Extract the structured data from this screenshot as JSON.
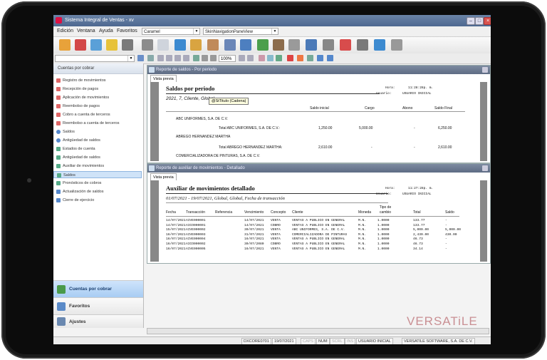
{
  "app": {
    "title": "Sistema Integral de Ventas - xv"
  },
  "menu": {
    "items": [
      "Edición",
      "Ventana",
      "Ayuda",
      "Favoritos"
    ],
    "theme_value": "Caramel",
    "skin_value": "SkinNavigationPaneView"
  },
  "toolbar": {
    "zoom": "100%"
  },
  "sidebar": {
    "header": "Cuentas por cobrar",
    "items": [
      {
        "label": "Registro de movimientos",
        "icon": "document-icon"
      },
      {
        "label": "Recepción de pagos",
        "icon": "document-icon"
      },
      {
        "label": "Aplicación de movimientos",
        "icon": "document-icon"
      },
      {
        "label": "Reembolso de pagos",
        "icon": "document-icon"
      },
      {
        "label": "Cobro a cuenta de terceros",
        "icon": "document-icon"
      },
      {
        "label": "Reembolso a cuenta de terceros",
        "icon": "document-icon"
      },
      {
        "label": "Saldos",
        "icon": "search-icon"
      },
      {
        "label": "Antigüedad de saldos",
        "icon": "search-icon"
      },
      {
        "label": "Estados de cuenta",
        "icon": "report-icon"
      },
      {
        "label": "Antigüedad de saldos",
        "icon": "report-icon"
      },
      {
        "label": "Auxiliar de movimientos",
        "icon": "report-icon"
      },
      {
        "label": "Saldos",
        "icon": "report-icon"
      },
      {
        "label": "Pronósticos de cobros",
        "icon": "report-icon"
      },
      {
        "label": "Actualización de saldos",
        "icon": "gear-icon"
      },
      {
        "label": "Cierre de ejercicio",
        "icon": "gear-icon"
      }
    ],
    "nav": [
      {
        "label": "Cuentas por cobrar",
        "icon": "money-icon"
      },
      {
        "label": "Favoritos",
        "icon": "star-icon"
      },
      {
        "label": "Ajustes",
        "icon": "gear-icon"
      }
    ]
  },
  "panel1": {
    "title": "Reporte de saldos - Por periodo",
    "tab": "Vista previa",
    "report_title": "Saldos por periodo",
    "subtitle": "2021, 7, Cliente, Global",
    "hora_label": "Hora:",
    "hora_value": "11:28:28p. m.",
    "usuario_label": "Usuario:",
    "usuario_value": "USUARIO INICIAL",
    "tooltip": "@StTitulo (Cadena)",
    "columns": [
      "Saldo inicial",
      "Cargo",
      "Abono",
      "Saldo Final"
    ],
    "lines": [
      {
        "name": "ABC UNIFORMES, S.A. DE C.V.",
        "total_label": "Total ABC UNIFORMES, S.A. DE C.V.:",
        "saldo_inicial": "1,250.00",
        "cargo": "5,000.00",
        "abono": "-",
        "saldo_final": "6,250.00"
      },
      {
        "name": "ABREGO HERNANDEZ MARTHA",
        "total_label": "Total ABREGO HERNANDEZ MARTHA:",
        "saldo_inicial": "2,610.00",
        "cargo": "-",
        "abono": "-",
        "saldo_final": "2,610.00"
      },
      {
        "name": "COMERCIALIZADORA DE PINTURAS, S.A. DE C.V."
      }
    ]
  },
  "panel2": {
    "title": "Reporte de auxiliar de movimientos - Detallado",
    "tab": "Vista previa",
    "report_title": "Auxiliar de movimientos detallado",
    "subtitle": "01/07/2021 - 19/07/2021, Global, Global, Fecha de transacción",
    "hora_label": "Hora:",
    "hora_value": "11:27:28p. m.",
    "usuario_label": "Usuario:",
    "usuario_value": "USUARIO INICIAL",
    "columns": [
      "Fecha",
      "Transacción",
      "Referencia",
      "Vencimiento",
      "Concepto",
      "Cliente",
      "Moneda",
      "Tipo de cambio",
      "Total",
      "Saldo"
    ],
    "rows": [
      [
        "14/07/2021",
        "AIVE000001",
        "",
        "14/07/2021",
        "VENTA",
        "VENTAS A PUBLICO EN GENERAL",
        "M.N.",
        "1.0000",
        "133.77",
        "-"
      ],
      [
        "14/07/2021",
        "AICO000001",
        "",
        "14/07/2021",
        "COBRO",
        "VENTAS A PUBLICO EN GENERAL",
        "M.N.",
        "1.0000",
        "133.77",
        "-"
      ],
      [
        "15/07/2021",
        "AIVE000002",
        "",
        "30/07/2021",
        "VENTA",
        "ABC UNIFORMES, S.A. DE C.V.",
        "M.N.",
        "1.0000",
        "5,000.00",
        "5,000.00"
      ],
      [
        "16/07/2021",
        "AIVE000003",
        "",
        "31/07/2021",
        "VENTA",
        "COMERCIALIZADORA DE PINTURAS",
        "M.N.",
        "1.0000",
        "2,430.00",
        "430.00"
      ],
      [
        "16/07/2021",
        "AIVE000004",
        "",
        "16/07/2021",
        "VENTA",
        "VENTAS A PUBLICO EN GENERAL",
        "M.N.",
        "1.0000",
        "46.73",
        "-"
      ],
      [
        "16/07/2021",
        "AICO000002",
        "",
        "30/07/2080",
        "COBRO",
        "VENTAS A PUBLICO EN GENERAL",
        "M.N.",
        "1.0000",
        "46.73",
        "-"
      ],
      [
        "16/07/2021",
        "AIVE000005",
        "",
        "16/07/2021",
        "VENTA",
        "VENTAS A PUBLICO EN GENERAL",
        "M.N.",
        "1.0000",
        "34.14",
        "-"
      ]
    ]
  },
  "status": {
    "items": [
      "DXCORE0701",
      "19/07/2021",
      "CAPS",
      "NUM",
      "SCRL",
      "INS",
      "USUARIO INICIAL",
      "VERSATILE SOFTWARE, S.A. DE C.V."
    ]
  },
  "logo": "VERSATiLE"
}
